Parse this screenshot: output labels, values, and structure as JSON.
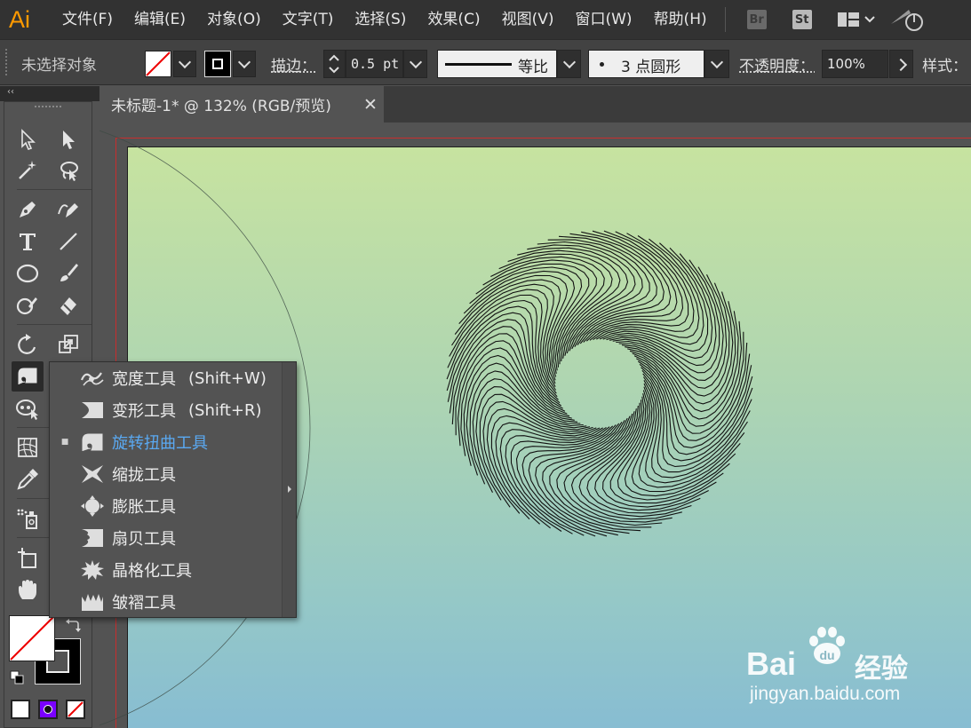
{
  "app": {
    "logo_text": "Ai"
  },
  "menu": {
    "items": [
      "文件(F)",
      "编辑(E)",
      "对象(O)",
      "文字(T)",
      "选择(S)",
      "效果(C)",
      "视图(V)",
      "窗口(W)",
      "帮助(H)"
    ],
    "bridge_label": "Br",
    "stock_label": "St"
  },
  "control_bar": {
    "selection_status": "未选择对象",
    "stroke_label": "描边：",
    "stroke_weight": "0.5 pt",
    "profile_label": "等比",
    "brush_label": "3 点圆形",
    "opacity_label": "不透明度：",
    "opacity_value": "100%",
    "style_label": "样式："
  },
  "document": {
    "tab_title": "未标题-1* @ 132% (RGB/预览)",
    "close_glyph": "✕"
  },
  "tools_panel": {
    "collapse_glyph": "‹‹"
  },
  "flyout": {
    "items": [
      {
        "label": "宽度工具",
        "shortcut": "(Shift+W)",
        "selected": false,
        "icon": "width-tool-icon"
      },
      {
        "label": "变形工具",
        "shortcut": "(Shift+R)",
        "selected": false,
        "icon": "warp-tool-icon"
      },
      {
        "label": "旋转扭曲工具",
        "shortcut": "",
        "selected": true,
        "icon": "twirl-tool-icon"
      },
      {
        "label": "缩拢工具",
        "shortcut": "",
        "selected": false,
        "icon": "pucker-tool-icon"
      },
      {
        "label": "膨胀工具",
        "shortcut": "",
        "selected": false,
        "icon": "bloat-tool-icon"
      },
      {
        "label": "扇贝工具",
        "shortcut": "",
        "selected": false,
        "icon": "scallop-tool-icon"
      },
      {
        "label": "晶格化工具",
        "shortcut": "",
        "selected": false,
        "icon": "crystallize-tool-icon"
      },
      {
        "label": "皱褶工具",
        "shortcut": "",
        "selected": false,
        "icon": "wrinkle-tool-icon"
      }
    ],
    "selected_bullet": "■",
    "highlight_color": "#5aa9f2"
  },
  "watermark": {
    "brand": "Bai",
    "brand_suffix": "经验",
    "url": "jingyan.baidu.com"
  },
  "colors": {
    "app_orange": "#ff9a00",
    "guide_red": "#c92d2d"
  }
}
